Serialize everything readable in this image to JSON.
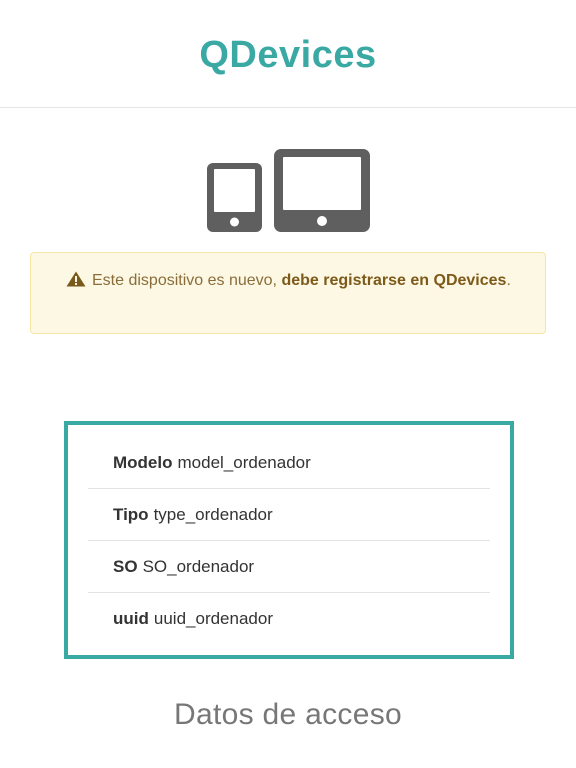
{
  "header": {
    "title": "QDevices"
  },
  "icons": {
    "devices": "phone-and-tablet-icon",
    "warning": "warning-triangle-icon"
  },
  "alert": {
    "text_normal": "Este dispositivo es nuevo, ",
    "text_bold": "debe registrarse en QDevices",
    "text_end": "."
  },
  "info": {
    "rows": [
      {
        "key": "Modelo",
        "value": "model_ordenador"
      },
      {
        "key": "Tipo",
        "value": "type_ordenador"
      },
      {
        "key": "SO",
        "value": "SO_ordenador"
      },
      {
        "key": "uuid",
        "value": "uuid_ordenador"
      }
    ]
  },
  "section": {
    "title": "Datos de acceso"
  },
  "colors": {
    "accent": "#3aa9a4",
    "alert_bg": "#fcf8e3",
    "alert_text": "#8a6d3b",
    "icon": "#5f5f5f"
  }
}
